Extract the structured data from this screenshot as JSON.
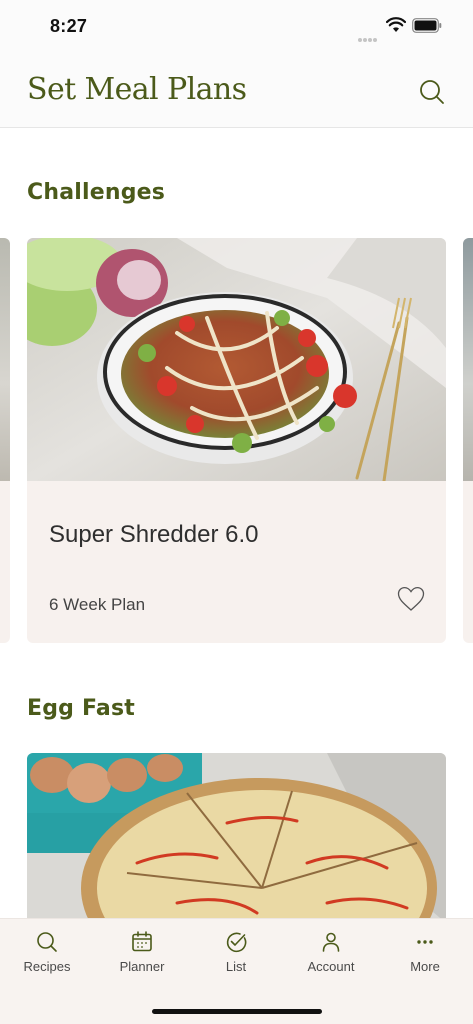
{
  "status_bar": {
    "time": "8:27"
  },
  "header": {
    "title": "Set Meal Plans",
    "search_icon": "search-icon"
  },
  "sections": [
    {
      "title": "Challenges",
      "cards": [
        {
          "title": "Super Shredder 6.0",
          "subtitle": "6 Week Plan",
          "favorite_icon": "heart-outline-icon"
        }
      ]
    },
    {
      "title": "Egg Fast"
    }
  ],
  "tab_bar": {
    "tabs": [
      {
        "label": "Recipes",
        "icon": "search-icon"
      },
      {
        "label": "Planner",
        "icon": "calendar-icon"
      },
      {
        "label": "List",
        "icon": "check-circle-icon"
      },
      {
        "label": "Account",
        "icon": "person-icon"
      },
      {
        "label": "More",
        "icon": "more-dots-icon"
      }
    ]
  },
  "colors": {
    "accent": "#4b5a1a",
    "card_bg": "#f7f1ee",
    "tab_bar_bg": "#f8f3f0"
  }
}
